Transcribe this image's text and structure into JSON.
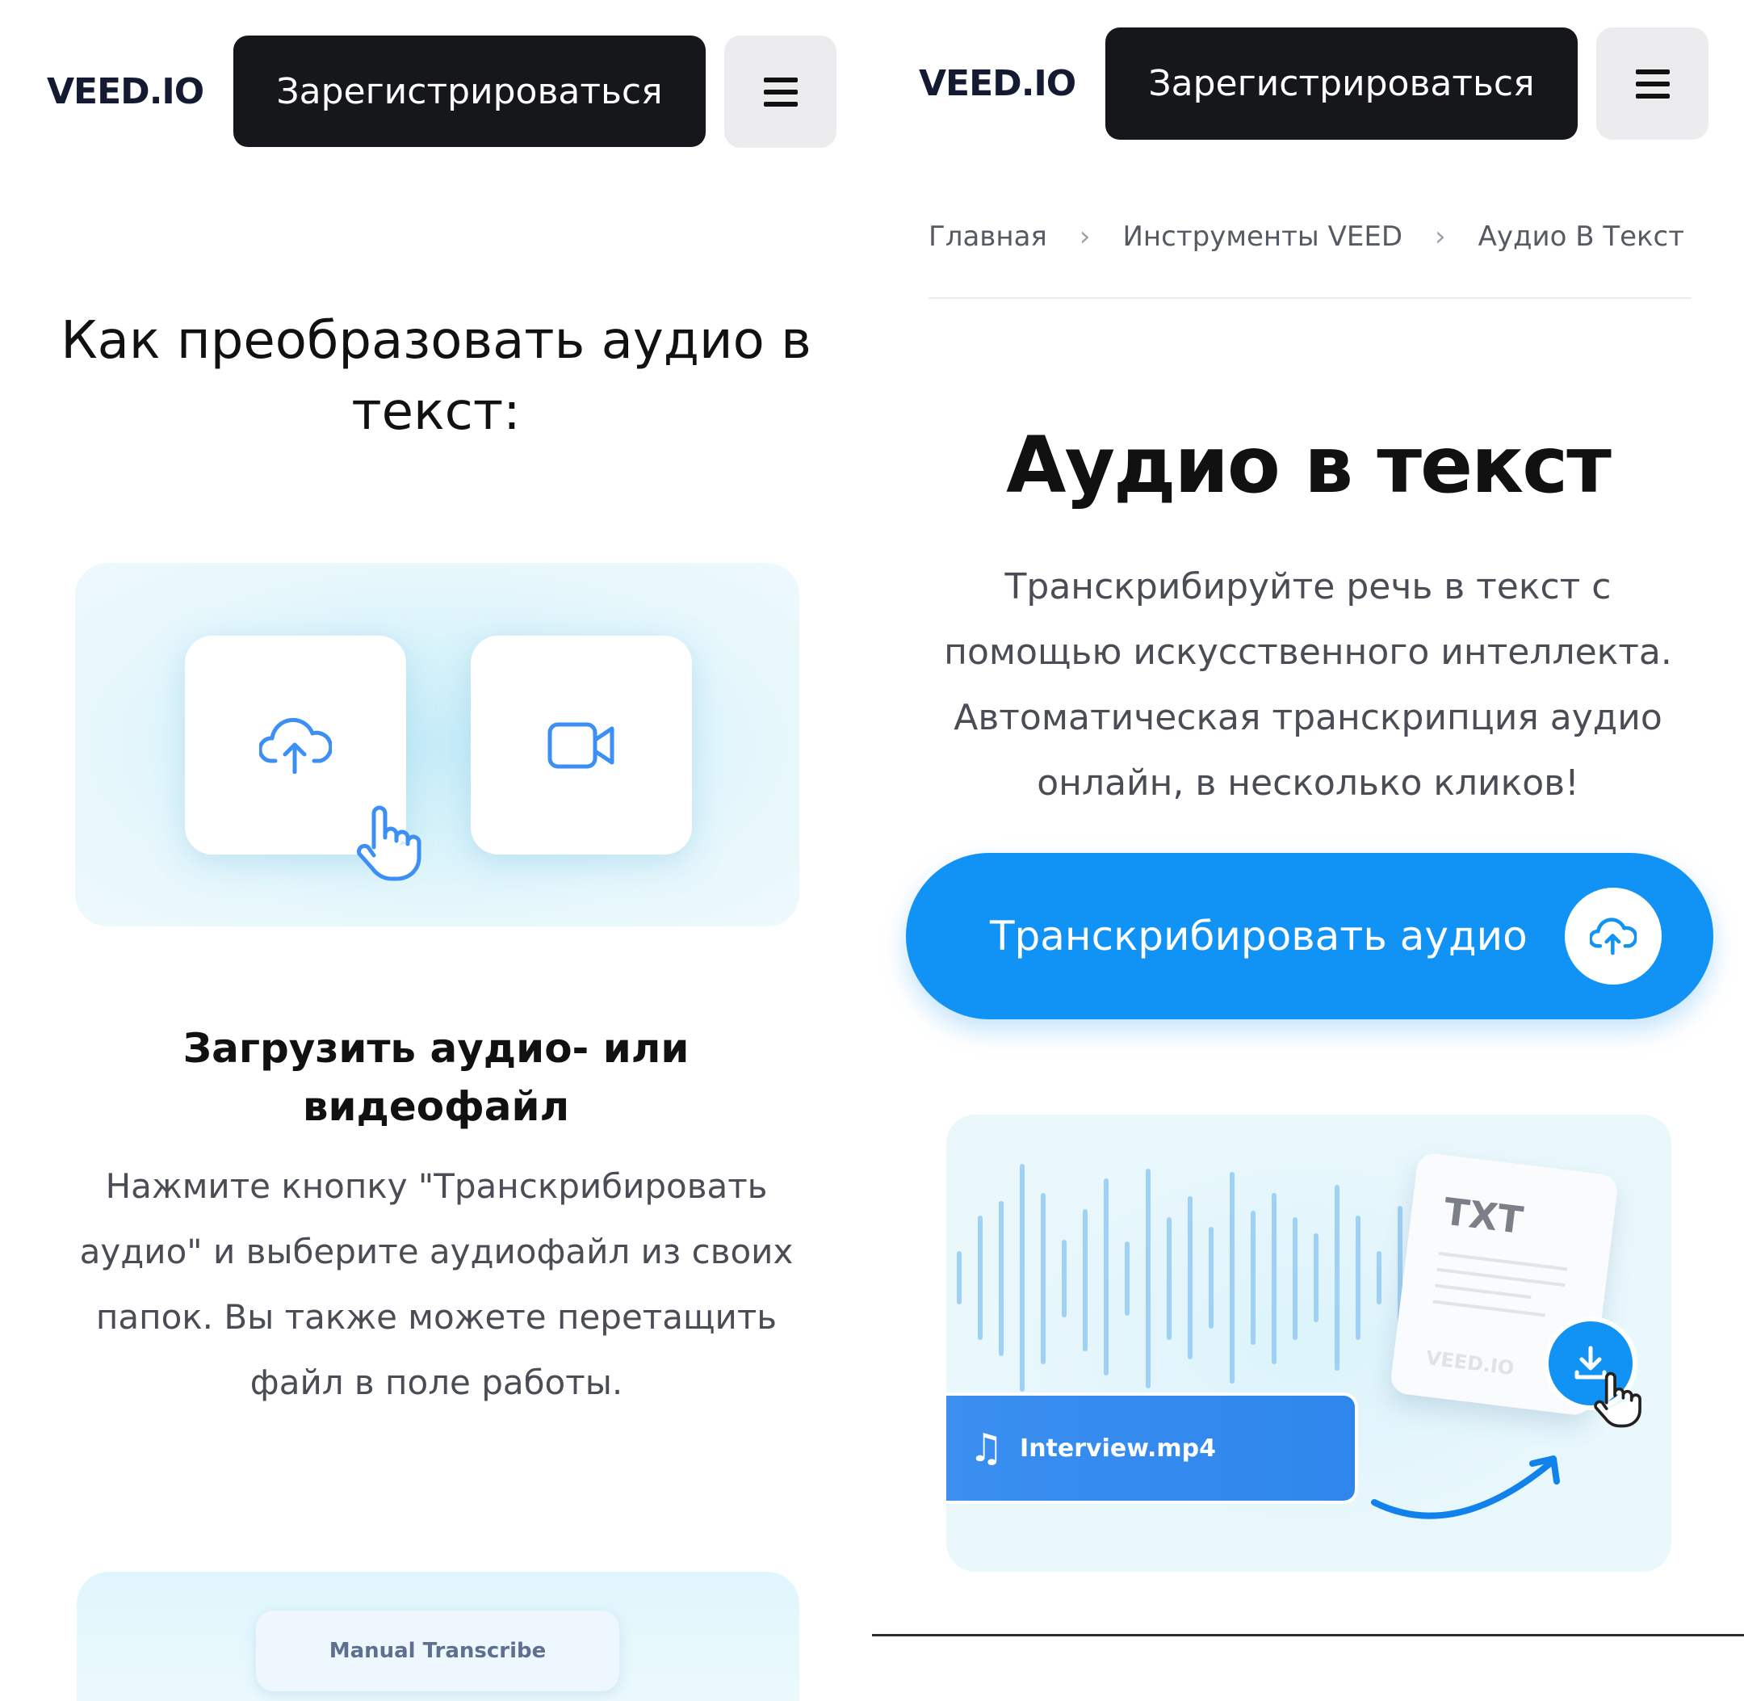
{
  "left": {
    "header": {
      "logo": "VEED.IO",
      "signup_label": "Зарегистрироваться"
    },
    "section_title": "Как преобразовать аудио в текст:",
    "step1": {
      "title": "Загрузить аудио- или видеофайл",
      "body": "Нажмите кнопку \"Транскрибировать аудио\" и выберите аудиофайл из своих папок. Вы также можете перетащить файл в поле работы."
    },
    "step2_preview": {
      "chip_label": "Manual Transcribe"
    }
  },
  "right": {
    "header": {
      "logo": "VEED.IO",
      "signup_label": "Зарегистрироваться"
    },
    "breadcrumb": [
      "Главная",
      "Инструменты VEED",
      "Аудио В Текст"
    ],
    "hero_title": "Аудио в текст",
    "hero_description": "Транскрибируйте речь в текст с помощью искусственного интеллекта. Автоматическая транскрипция аудио онлайн, в несколько кликов!",
    "cta_label": "Транскрибировать аудио",
    "illustration": {
      "file_name": "Interview.mp4",
      "doc_label": "TXT",
      "doc_watermark": "VEED.IO"
    }
  },
  "colors": {
    "accent": "#1192f5",
    "dark": "#16171b",
    "light_blue": "#dff4fb"
  },
  "icons": [
    "hamburger-menu-icon",
    "cloud-upload-icon",
    "video-camera-icon",
    "pointer-hand-icon",
    "chevron-right-icon",
    "music-note-icon",
    "download-icon"
  ]
}
